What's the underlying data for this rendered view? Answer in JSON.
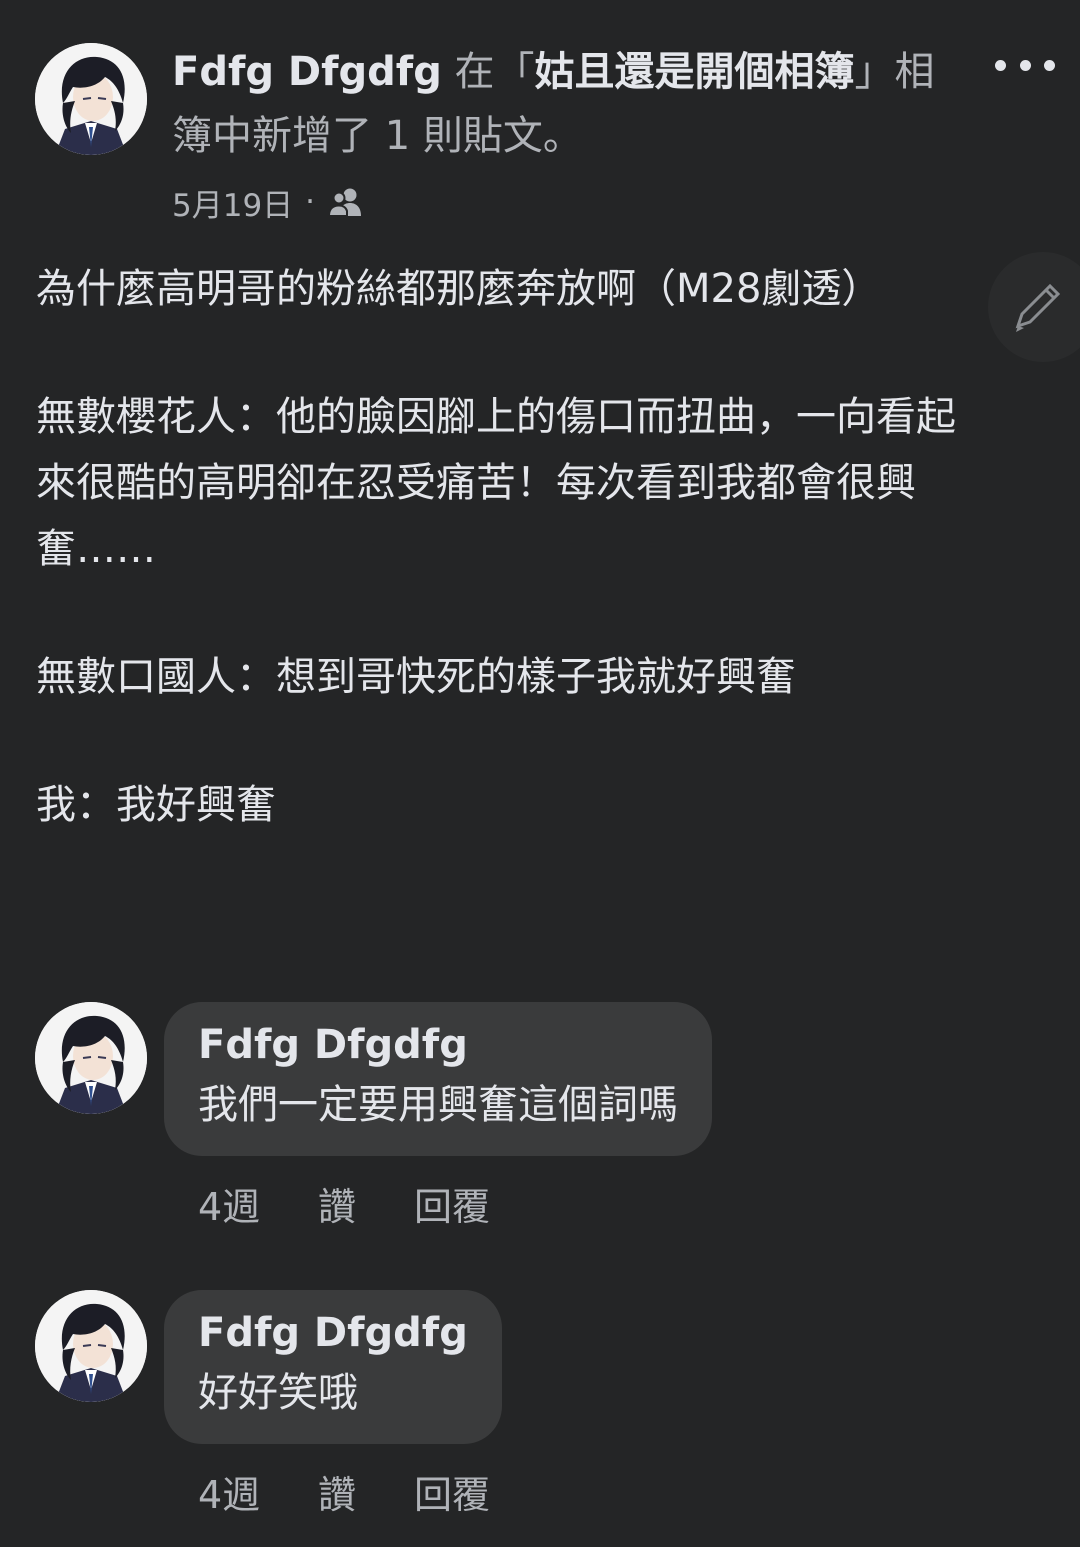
{
  "post": {
    "author": "Fdfg Dfgdfg",
    "in_word": "在",
    "album_open": "「",
    "album_name": "姑且還是開個相簿",
    "album_close": "」",
    "suffix": "相簿中新增了 1 則貼文。",
    "date": "5月19日",
    "dot": "·",
    "audience_icon": "friends-icon",
    "body": {
      "line1": "為什麼高明哥的粉絲都那麼奔放啊（M28劇透）",
      "para2_l1": "無數櫻花人：他的臉因腳上的傷口而扭曲，一向看起",
      "para2_l2": "來很酷的高明卻在忍受痛苦！每次看到我都會很興",
      "para2_l3": "奮……",
      "para3": "無數口國人：想到哥快死的樣子我就好興奮",
      "para4": "我：我好興奮"
    }
  },
  "comments": [
    {
      "author": "Fdfg Dfgdfg",
      "text": "我們一定要用興奮這個詞嗎",
      "time": "4週",
      "like": "讚",
      "reply": "回覆"
    },
    {
      "author": "Fdfg Dfgdfg",
      "text": "好好笑哦",
      "time": "4週",
      "like": "讚",
      "reply": "回覆"
    }
  ],
  "icons": {
    "more": "more-options-icon",
    "edit": "pencil-icon"
  },
  "colors": {
    "background": "#242526",
    "bubble": "#3a3b3c",
    "primary_text": "#e4e6eb",
    "secondary_text": "#b0b3b8"
  }
}
